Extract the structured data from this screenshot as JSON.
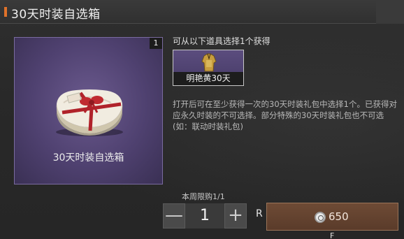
{
  "header": {
    "title": "30天时装自选箱"
  },
  "item": {
    "name": "30天时装自选箱",
    "quantity": "1"
  },
  "panel": {
    "choose_label": "可从以下道具选择1个获得",
    "options": [
      {
        "label": "明艳黄30天"
      }
    ],
    "description": "打开后可在至少获得一次的30天时装礼包中选择1个。已获得对应永久时装的不可选择。部分特殊的30天时装礼包也不可选(如：联动时装礼包)"
  },
  "purchase": {
    "limit_text": "本周限购1/1",
    "quantity": "1",
    "minus_symbol": "—",
    "plus_symbol": "+",
    "hotkey_left": "R",
    "price": "650",
    "hotkey_buy": "F",
    "currency_icon": "coin-icon"
  },
  "colors": {
    "accent": "#e0722a",
    "card_purple": "#5b4d80",
    "buy_button": "#6a4733"
  }
}
